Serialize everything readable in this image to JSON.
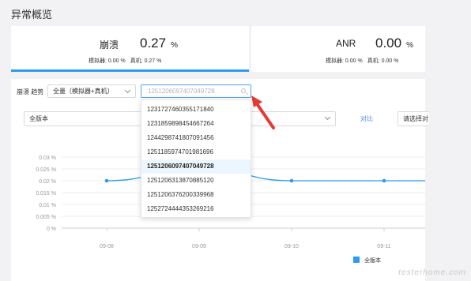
{
  "page": {
    "title": "异常概览"
  },
  "cards": {
    "crash": {
      "name": "崩溃",
      "rate": "0.27",
      "unit": "%",
      "emulator": "模拟器: 0.00 %",
      "device": "真机: 0.27 %"
    },
    "anr": {
      "name": "ANR",
      "rate": "0.00",
      "unit": "%",
      "emulator": "模拟器: 0.00 %",
      "device": "真机: 0.00 %"
    }
  },
  "filters": {
    "trend_label": "崩溃 趋势",
    "type_select": "全量（模拟器+真机）",
    "search_value": "1251206097407049728",
    "version_select": "全版本",
    "compare_link": "对比",
    "choose_select": "请选择对比"
  },
  "dropdown": {
    "selected_index": 4,
    "options": [
      "1231727460355171840",
      "1231859898454667264",
      "1244298741807091456",
      "1251185974701981696",
      "1251206097407049728",
      "1251206313870885120",
      "1251206376200339968",
      "1252724444353269216"
    ]
  },
  "chart_data": {
    "type": "line",
    "y_ticks": [
      "0.03 %",
      "0.025 %",
      "0.02 %",
      "0.015 %",
      "0.01 %",
      "0.005 %",
      "0 %"
    ],
    "ylim": [
      0,
      0.03
    ],
    "categories": [
      "09-08",
      "09-09",
      "09-10",
      "09-11"
    ],
    "series": [
      {
        "name": "全版本",
        "color": "#2d9cf0",
        "values": [
          0.02,
          0.0255,
          0.02,
          0.02
        ]
      }
    ],
    "legend": "bottom-right",
    "grid": true
  },
  "watermark": "testerhome.com"
}
